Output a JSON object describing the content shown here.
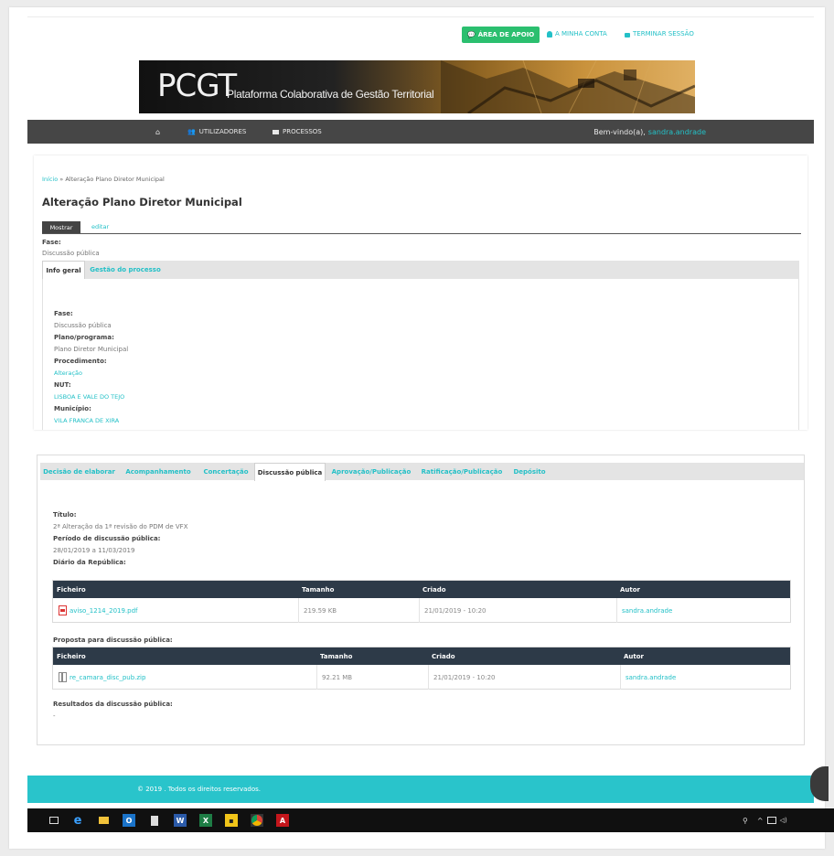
{
  "top_nav": {
    "apoio": "ÁREA DE APOIO",
    "conta": "A MINHA CONTA",
    "sessao": "TERMINAR SESSÃO"
  },
  "banner": {
    "logo": "PCGT",
    "subtitle": "Plataforma Colaborativa de Gestão Territorial"
  },
  "main_nav": {
    "utilizadores": "UTILIZADORES",
    "processos": "PROCESSOS",
    "welcome": "Bem-vindo(a),",
    "user": "sandra.andrade"
  },
  "breadcrumb": {
    "home": "Início",
    "separator": "»",
    "current": "Alteração Plano Diretor Municipal"
  },
  "page": {
    "title": "Alteração Plano Diretor Municipal",
    "view_tab": "Mostrar",
    "edit_tab": "editar",
    "fase_label": "Fase:",
    "fase_value": "Discussão pública"
  },
  "main_tabs": [
    "Info geral",
    "Gestão do processo"
  ],
  "info_geral": {
    "fase_label": "Fase:",
    "fase_value": "Discussão pública",
    "plano_label": "Plano/programa:",
    "plano_value": "Plano Diretor Municipal",
    "procedimento_label": "Procedimento:",
    "procedimento_value": "Alteração",
    "nut_label": "NUT:",
    "nut_value": "LISBOA E VALE DO TEJO",
    "municipio_label": "Município:",
    "municipio_value": "VILA FRANCA DE XIRA"
  },
  "phase_tabs": [
    "Decisão de elaborar",
    "Acompanhamento",
    "Concertação",
    "Discussão pública",
    "Aprovação/Publicação",
    "Ratificação/Publicação",
    "Depósito"
  ],
  "discussao": {
    "titulo_label": "Título:",
    "titulo_value": "2ª Alteração da 1ª revisão do PDM de VFX",
    "periodo_label": "Período de discussão pública:",
    "periodo_value": "28/01/2019 a 11/03/2019",
    "diario_label": "Diário da República:",
    "proposta_label": "Proposta para discussão pública:",
    "resultados_label": "Resultados da discussão pública:",
    "resultados_value": "-"
  },
  "table_headers": {
    "ficheiro": "Ficheiro",
    "tamanho": "Tamanho",
    "criado": "Criado",
    "autor": "Autor"
  },
  "diario_file": {
    "name": "aviso_1214_2019.pdf",
    "size": "219.59 KB",
    "created": "21/01/2019 - 10:20",
    "author": "sandra.andrade"
  },
  "proposta_file": {
    "name": "re_camara_disc_pub.zip",
    "size": "92.21 MB",
    "created": "21/01/2019 - 10:20",
    "author": "sandra.andrade"
  },
  "footer": {
    "text": "© 2019 . Todos os direitos reservados."
  },
  "colors": {
    "accent": "#23c0c7",
    "apoio_green": "#2bbf6f",
    "nav_dark": "#464646",
    "table_header": "#2d3a48",
    "footer": "#29c4cb"
  }
}
